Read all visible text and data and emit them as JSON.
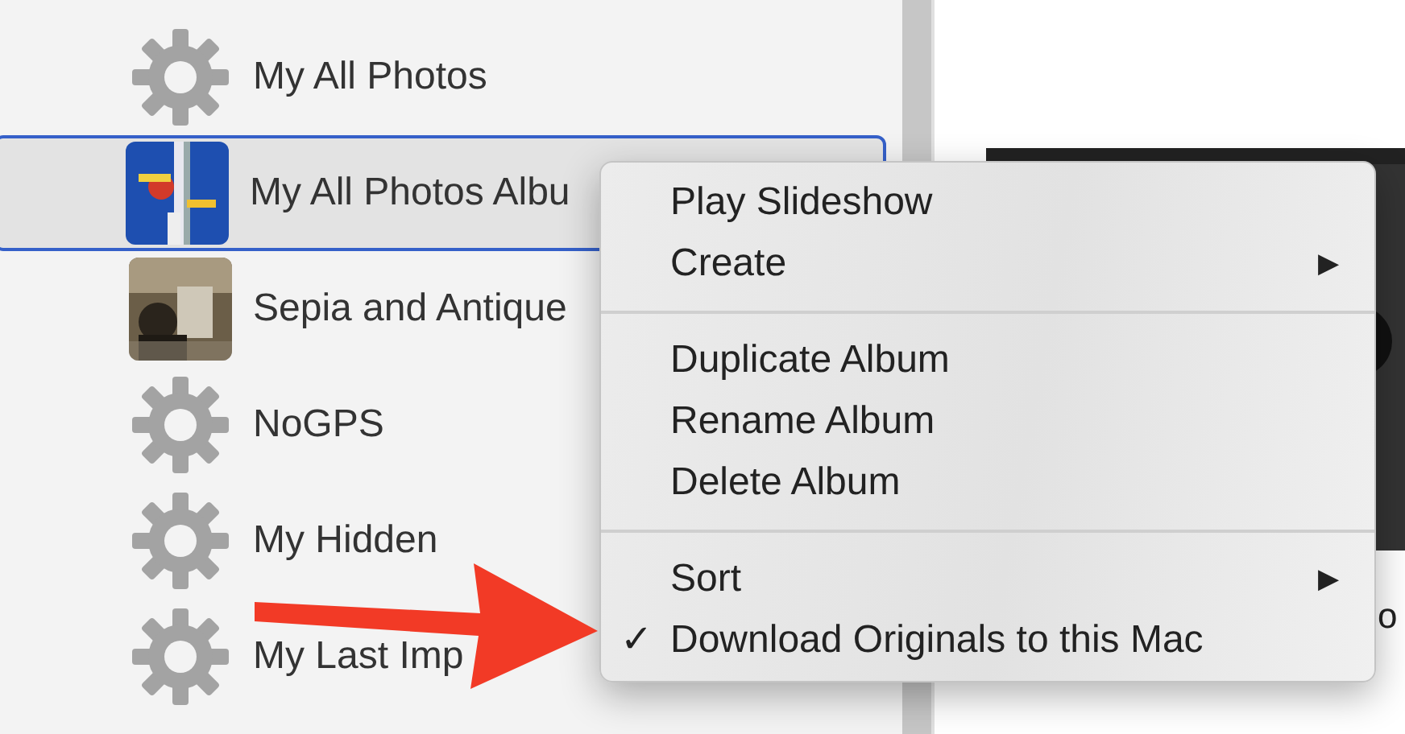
{
  "sidebar": {
    "items": [
      {
        "label": "My All Photos",
        "kind": "gear",
        "selected": false
      },
      {
        "label": "My All Photos Albu",
        "selected": true
      },
      {
        "label": "Sepia and Antique",
        "selected": false
      },
      {
        "label": "NoGPS",
        "kind": "gear",
        "selected": false
      },
      {
        "label": "My Hidden",
        "kind": "gear",
        "selected": false
      },
      {
        "label": "My Last Imp",
        "kind": "gear",
        "selected": false
      }
    ]
  },
  "content": {
    "caption": "o"
  },
  "context_menu": {
    "sections": [
      [
        {
          "label": "Play Slideshow",
          "submenu": false,
          "checked": false
        },
        {
          "label": "Create",
          "submenu": true,
          "checked": false
        }
      ],
      [
        {
          "label": "Duplicate Album",
          "submenu": false,
          "checked": false
        },
        {
          "label": "Rename Album",
          "submenu": false,
          "checked": false
        },
        {
          "label": "Delete Album",
          "submenu": false,
          "checked": false
        }
      ],
      [
        {
          "label": "Sort",
          "submenu": true,
          "checked": false
        },
        {
          "label": "Download Originals to this Mac",
          "submenu": false,
          "checked": true
        }
      ]
    ]
  },
  "check_mark": "✓",
  "submenu_mark": "▶"
}
